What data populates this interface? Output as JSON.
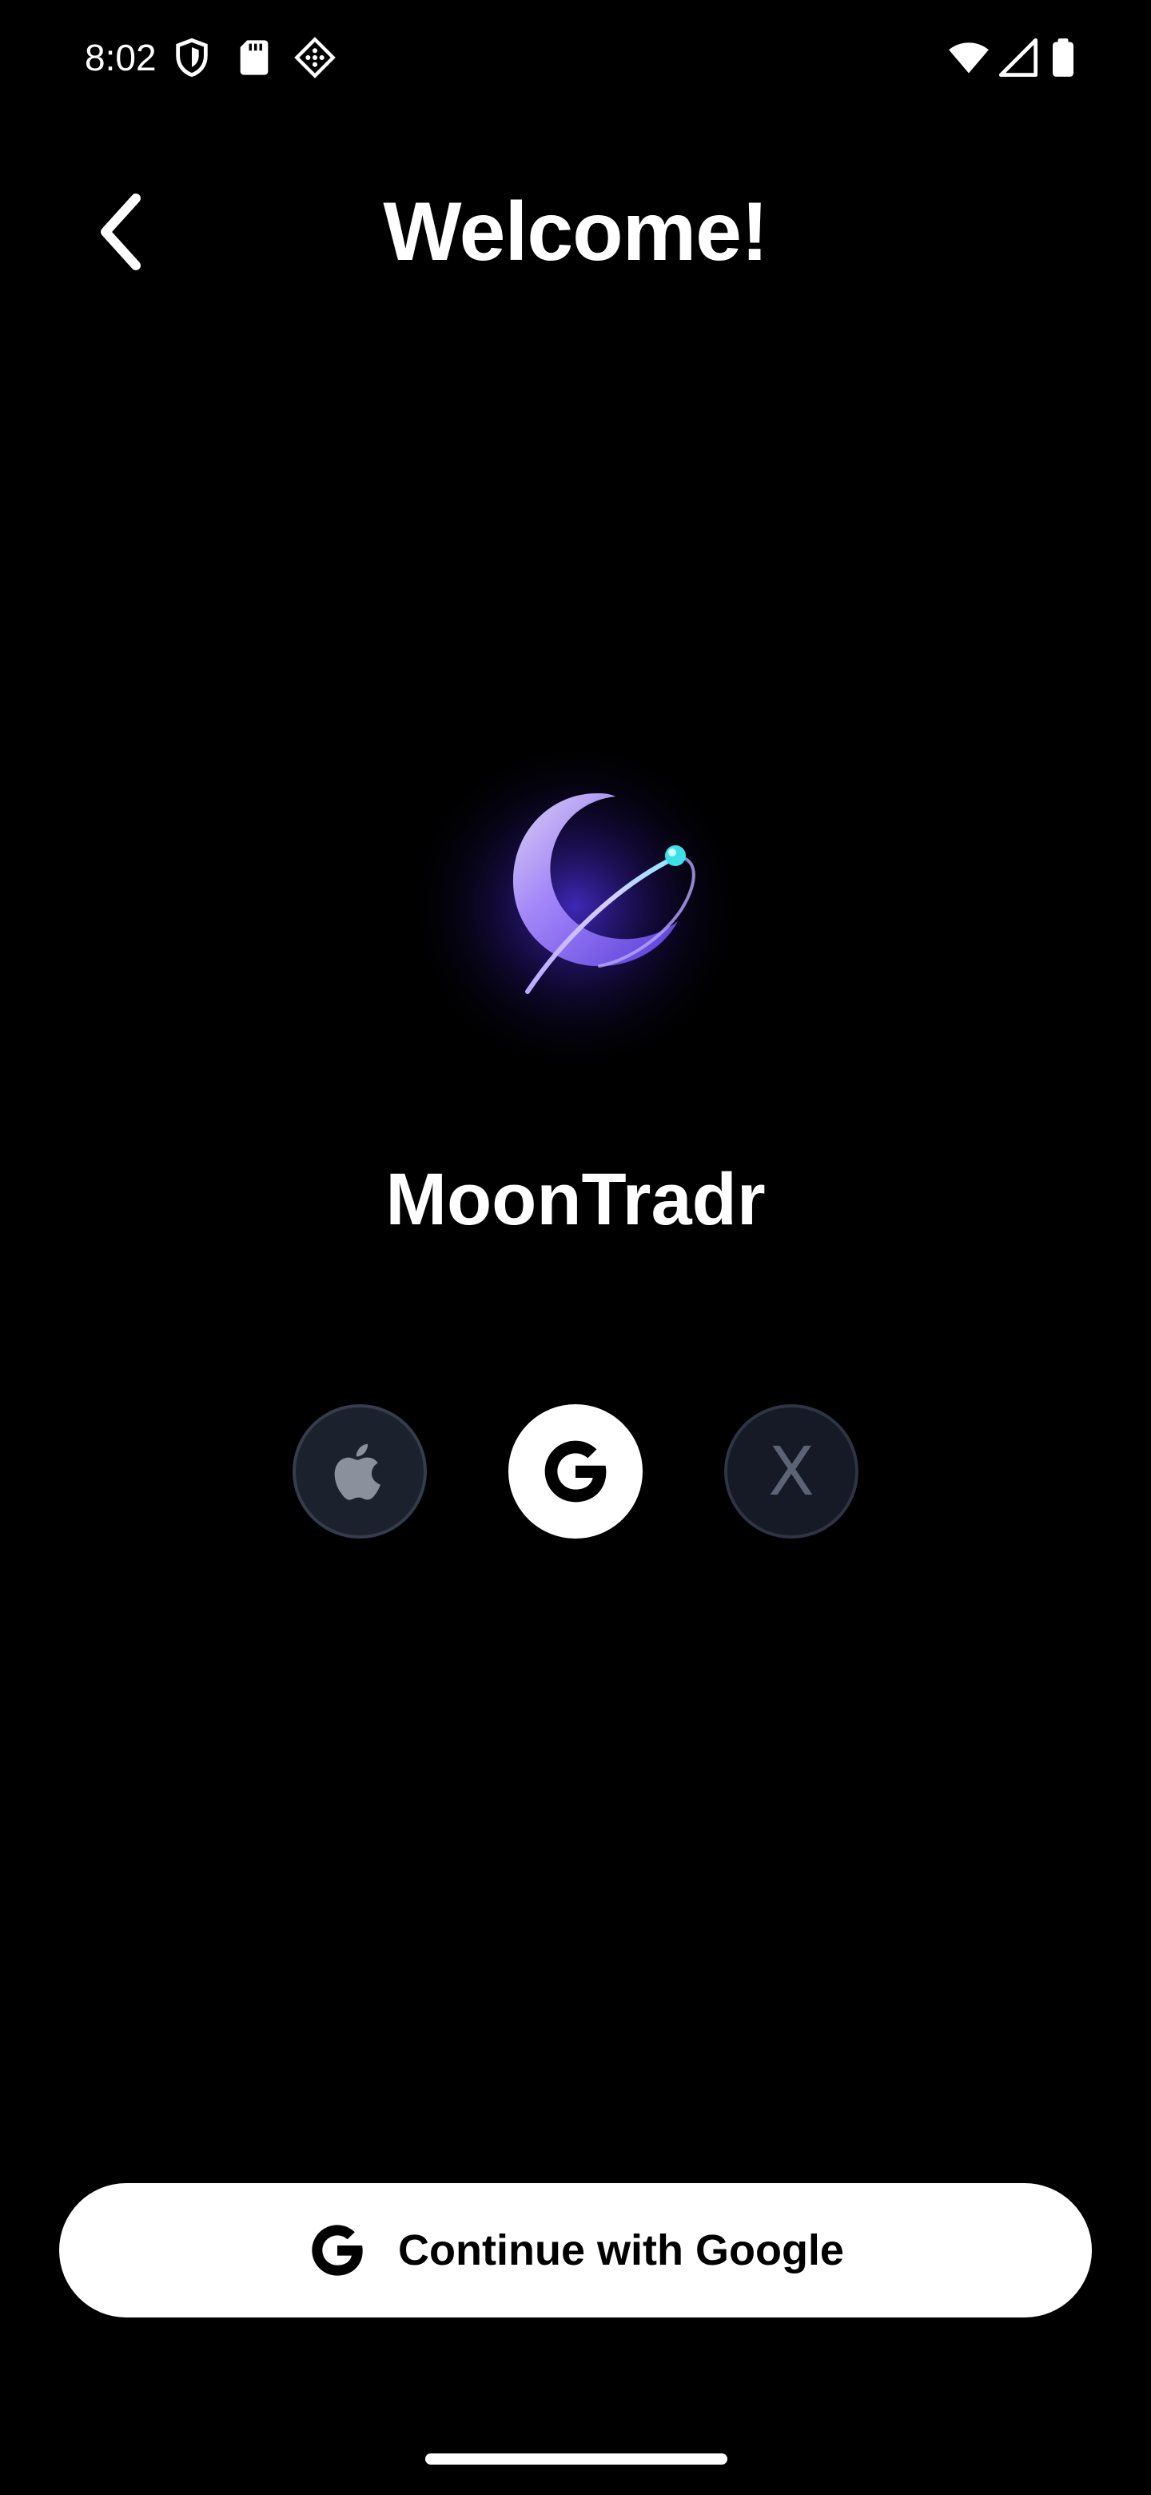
{
  "status_bar": {
    "time": "8:02",
    "left_icons": [
      "shield-icon",
      "sd-card-icon",
      "diamond-grid-icon"
    ],
    "right_icons": [
      "wifi-icon",
      "cellular-signal-icon",
      "battery-icon"
    ]
  },
  "header": {
    "back_icon": "chevron-left-icon",
    "title": "Welcome!"
  },
  "app": {
    "logo_icon": "moon-orbit-logo-icon",
    "name": "MoonTradr"
  },
  "providers": [
    {
      "id": "apple",
      "icon": "apple-icon",
      "selected": false
    },
    {
      "id": "google",
      "icon": "google-icon",
      "selected": true
    },
    {
      "id": "x",
      "icon": "x-icon",
      "label": "X",
      "selected": false
    }
  ],
  "continue_button": {
    "icon": "google-icon",
    "label": "Continue with Google"
  },
  "colors": {
    "background": "#000000",
    "text": "#ffffff",
    "button_bg": "#ffffff",
    "button_text": "#000000",
    "provider_dark_bg": "#1c212e",
    "provider_border": "#353c4c",
    "logo_purple": "#7a5cff",
    "logo_cyan": "#3de0e6"
  }
}
